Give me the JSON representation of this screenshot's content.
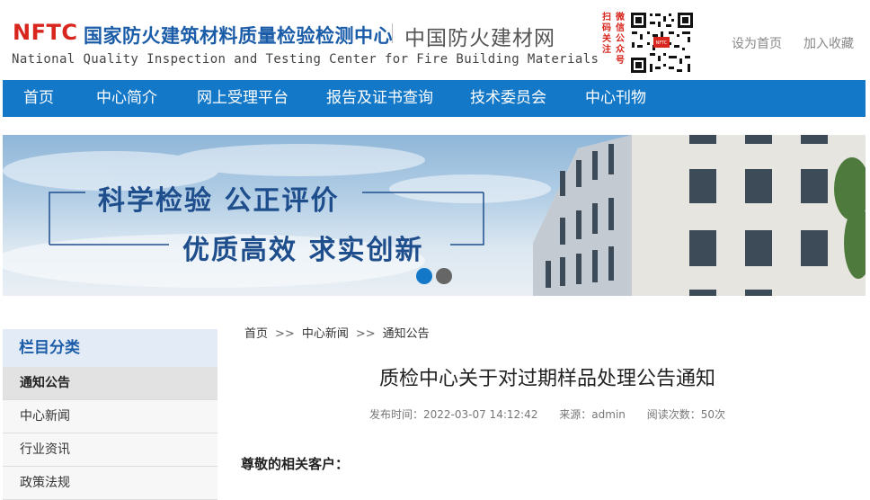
{
  "header": {
    "logo": "NFTC",
    "org_name_cn": "国家防火建筑材料质量检验检测中心",
    "site_name": "中国防火建材网",
    "org_name_en": "National Quality Inspection and Testing  Center for Fire Building Materials",
    "qr_caption_left": "扫码关注",
    "qr_caption_right": "微信公众号",
    "set_home": "设为首页",
    "add_favorite": "加入收藏",
    "brand_color": "#d8261e",
    "accent_color": "#1478c8"
  },
  "nav": {
    "items": [
      "首页",
      "中心简介",
      "网上受理平台",
      "报告及证书查询",
      "技术委员会",
      "中心刊物"
    ]
  },
  "banner": {
    "slogan_line1": "科学检验  公正评价",
    "slogan_line2": "优质高效  求实创新",
    "slide_count": 2,
    "active_slide": 1
  },
  "sidebar": {
    "title": "栏目分类",
    "items": [
      "通知公告",
      "中心新闻",
      "行业资讯",
      "政策法规"
    ],
    "active_index": 0
  },
  "breadcrumb": {
    "home": "首页",
    "level1": "中心新闻",
    "level2": "通知公告",
    "separator": ">>"
  },
  "article": {
    "title": "质检中心关于对过期样品处理公告通知",
    "published": "发布时间：2022-03-07 14:12:42",
    "source": "来源：admin",
    "views": "阅读次数：50次",
    "greeting": "尊敬的相关客户："
  }
}
